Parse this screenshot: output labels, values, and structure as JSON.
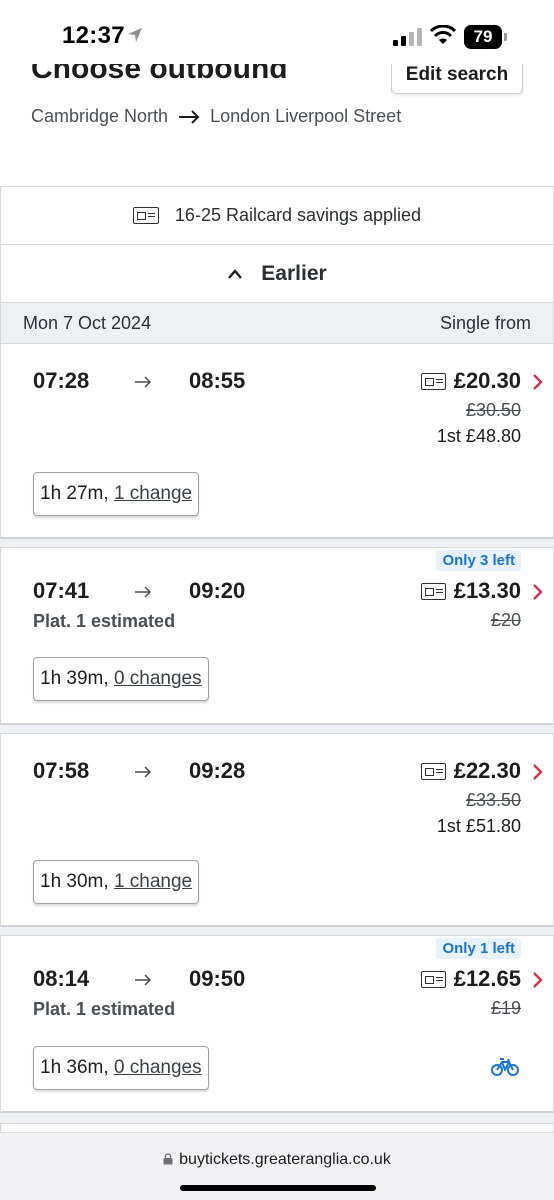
{
  "status_bar": {
    "time": "12:37",
    "battery": "79"
  },
  "header": {
    "title": "Choose outbound",
    "edit_button": "Edit search",
    "origin": "Cambridge North",
    "destination": "London Liverpool Street"
  },
  "results": {
    "railcard_text": "16-25 Railcard savings applied",
    "earlier_label": "Earlier",
    "date": "Mon 7 Oct 2024",
    "price_header": "Single from"
  },
  "journeys": [
    {
      "depart": "07:28",
      "arrive": "08:55",
      "platform": "",
      "price": "£20.30",
      "old_price": "£30.50",
      "first_class": "1st £48.80",
      "badge": "",
      "duration": "1h 27m,",
      "changes": "1 change"
    },
    {
      "depart": "07:41",
      "arrive": "09:20",
      "platform": "Plat. 1 estimated",
      "price": "£13.30",
      "old_price": "£20",
      "first_class": "",
      "badge": "Only 3 left",
      "duration": "1h 39m,",
      "changes": "0 changes"
    },
    {
      "depart": "07:58",
      "arrive": "09:28",
      "platform": "",
      "price": "£22.30",
      "old_price": "£33.50",
      "first_class": "1st £51.80",
      "badge": "",
      "duration": "1h 30m,",
      "changes": "1 change"
    },
    {
      "depart": "08:14",
      "arrive": "09:50",
      "platform": "Plat. 1 estimated",
      "price": "£12.65",
      "old_price": "£19",
      "first_class": "",
      "badge": "Only 1 left",
      "duration": "1h 36m,",
      "changes": "0 changes"
    }
  ],
  "browser": {
    "url": "buytickets.greateranglia.co.uk"
  },
  "colors": {
    "chevron": "#d6304a",
    "badge_text": "#1a73d0",
    "badge_bg": "#e8f2fc",
    "bike": "#1a73d0"
  },
  "icons": {
    "railcard": "railcard-icon",
    "bike": "bicycle-icon",
    "chevron": "chevron-right-icon"
  }
}
